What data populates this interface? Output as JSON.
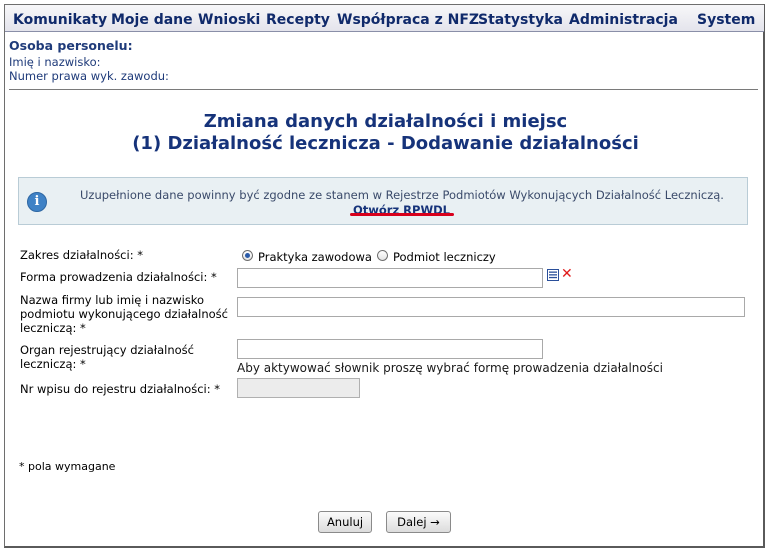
{
  "menu": {
    "items": [
      "Komunikaty",
      "Moje dane",
      "Wnioski",
      "Recepty",
      "Współpraca z NFZ",
      "Statystyka",
      "Administracja",
      "System"
    ]
  },
  "person": {
    "title": "Osoba personelu:",
    "name_label": "Imię i nazwisko:",
    "license_label": "Numer prawa wyk. zawodu:"
  },
  "page": {
    "title_line1": "Zmiana danych działalności i miejsc",
    "title_line2": "(1) Działalność lecznicza - Dodawanie działalności"
  },
  "info": {
    "text": "Uzupełnione dane powinny być zgodne ze stanem w Rejestrze Podmiotów Wykonujących Działalność Leczniczą.",
    "link": "Otwórz RPWDL",
    "icon": "info-icon"
  },
  "form": {
    "scope_label": "Zakres działalności: *",
    "scope_options": [
      "Praktyka zawodowa",
      "Podmiot leczniczy"
    ],
    "scope_selected": "Praktyka zawodowa",
    "form_label": "Forma prowadzenia działalności: *",
    "form_value": "",
    "name_label": "Nazwa firmy lub imię i nazwisko podmiotu wykonującego działalność leczniczą: *",
    "name_value": "",
    "organ_label": "Organ rejestrujący działalność leczniczą: *",
    "organ_value": "",
    "organ_hint": "Aby aktywować słownik proszę wybrać formę prowadzenia działalności",
    "registry_label": "Nr wpisu do rejestru działalności: *",
    "registry_value": ""
  },
  "footer": {
    "required_note": "* pola wymagane",
    "cancel_label": "Anuluj",
    "next_label": "Dalej →"
  },
  "colors": {
    "menu_text": "#102a6b",
    "title": "#16337a",
    "info_bg": "#e9f0f3",
    "accent_red": "#d8001c",
    "radio_dot": "#2a5aa8"
  }
}
